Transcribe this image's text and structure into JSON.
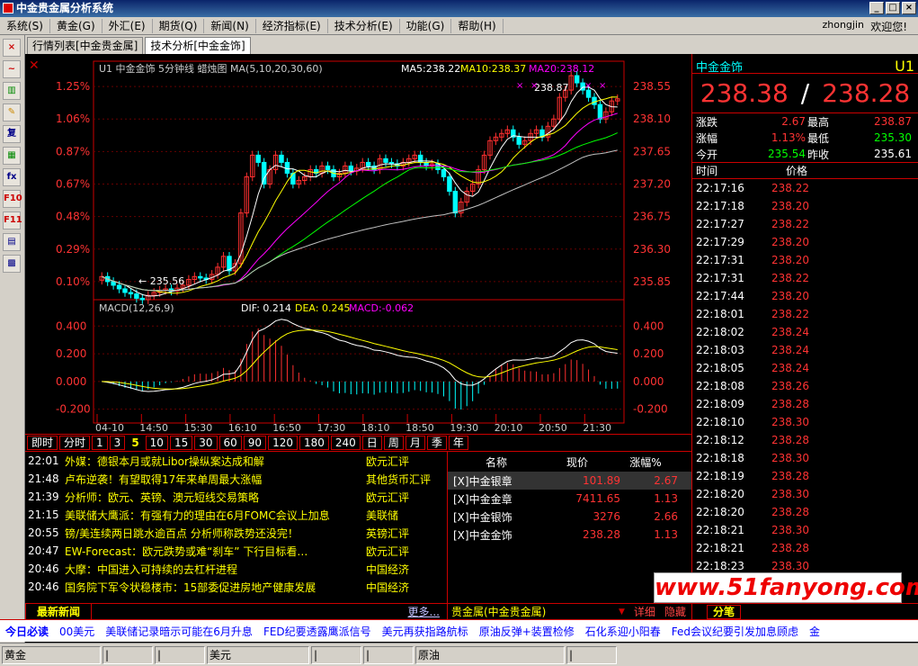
{
  "window": {
    "title": "中金贵金属分析系统"
  },
  "menu": {
    "items": [
      "系统(S)",
      "黄金(G)",
      "外汇(E)",
      "期货(Q)",
      "新闻(N)",
      "经济指标(E)",
      "技术分析(E)",
      "功能(G)",
      "帮助(H)"
    ],
    "user": "zhongjin",
    "welcome": "欢迎您!"
  },
  "tabs": [
    "行情列表[中金贵金属]",
    "技术分析[中金金饰]"
  ],
  "toolbar_icons": [
    "×",
    "~",
    "▥",
    "✎",
    "复",
    "▦",
    "fx",
    "F10",
    "F11",
    "▤",
    "▩"
  ],
  "chart": {
    "header": "U1 中金金饰 5分钟线 蜡烛图 MA(5,10,20,30,60)",
    "ma5": "MA5:238.22",
    "ma10": "MA10:238.37",
    "ma20": "MA20:238.12",
    "high_mark": "238.87",
    "low_mark": "← 235.56",
    "pct_labels": [
      "1.25%",
      "1.06%",
      "0.87%",
      "0.67%",
      "0.48%",
      "0.29%",
      "0.10%"
    ],
    "price_labels": [
      "238.55",
      "238.10",
      "237.65",
      "237.20",
      "236.75",
      "236.30",
      "235.85"
    ],
    "macd_header": "MACD(12,26,9)",
    "dif": "DIF: 0.214",
    "dea": "DEA: 0.245",
    "macd": "MACD:-0.062",
    "macd_labels": [
      "0.400",
      "0.200",
      "0.000",
      "-0.200"
    ],
    "time_labels": [
      "04-10",
      "14:50",
      "15:30",
      "16:10",
      "16:50",
      "17:30",
      "18:10",
      "18:50",
      "19:30",
      "20:10",
      "20:50",
      "21:30"
    ],
    "colors": {
      "up": "#ff3030",
      "down": "#00ffff",
      "ma5": "#ffffff",
      "ma10": "#ffff00",
      "ma20": "#ff00ff",
      "ma30": "#00ff00",
      "ma60": "#c0c0c0"
    }
  },
  "chart_data": {
    "type": "candlestick",
    "title": "U1 中金金饰 5分钟线 蜡烛图 MA(5,10,20,30,60)",
    "ylim": [
      235.6,
      238.9
    ],
    "close": [
      235.92,
      235.85,
      235.8,
      235.75,
      235.7,
      235.68,
      235.62,
      235.6,
      235.66,
      235.7,
      235.73,
      235.75,
      235.72,
      235.76,
      235.8,
      235.88,
      235.92,
      235.9,
      235.88,
      235.95,
      236.05,
      236.2,
      236.0,
      236.1,
      236.8,
      237.3,
      237.6,
      237.5,
      237.2,
      237.4,
      237.6,
      237.5,
      237.35,
      237.2,
      237.25,
      237.3,
      237.4,
      237.35,
      237.45,
      237.4,
      237.3,
      237.35,
      237.45,
      237.38,
      237.42,
      237.5,
      237.45,
      237.4,
      237.55,
      237.5,
      237.48,
      237.45,
      237.5,
      237.55,
      237.6,
      237.5,
      237.45,
      237.48,
      237.4,
      237.3,
      237.1,
      236.8,
      236.95,
      237.1,
      237.2,
      237.4,
      237.6,
      237.8,
      237.85,
      237.9,
      237.95,
      237.85,
      237.75,
      237.8,
      237.9,
      237.95,
      237.85,
      238.0,
      238.1,
      238.4,
      238.5,
      238.7,
      238.6,
      238.5,
      238.4,
      238.3,
      238.1,
      238.2,
      238.35,
      238.38
    ]
  },
  "quote": {
    "symbol_name": "中金金饰",
    "symbol_code": "U1",
    "bid": "238.38",
    "sep": "/",
    "ask": "238.28",
    "rows": [
      [
        "涨跌",
        "2.67",
        "最高",
        "238.87"
      ],
      [
        "涨幅",
        "1.13%",
        "最低",
        "235.30"
      ],
      [
        "今开",
        "235.54",
        "昨收",
        "235.61"
      ]
    ],
    "ticks_header": [
      "时间",
      "价格"
    ],
    "ticks": [
      [
        "22:17:16",
        "238.22"
      ],
      [
        "22:17:18",
        "238.20"
      ],
      [
        "22:17:27",
        "238.22"
      ],
      [
        "22:17:29",
        "238.20"
      ],
      [
        "22:17:31",
        "238.20"
      ],
      [
        "22:17:31",
        "238.22"
      ],
      [
        "22:17:44",
        "238.20"
      ],
      [
        "22:18:01",
        "238.22"
      ],
      [
        "22:18:02",
        "238.24"
      ],
      [
        "22:18:03",
        "238.24"
      ],
      [
        "22:18:05",
        "238.24"
      ],
      [
        "22:18:08",
        "238.26"
      ],
      [
        "22:18:09",
        "238.28"
      ],
      [
        "22:18:10",
        "238.30"
      ],
      [
        "22:18:12",
        "238.28"
      ],
      [
        "22:18:18",
        "238.30"
      ],
      [
        "22:18:19",
        "238.28"
      ],
      [
        "22:18:20",
        "238.30"
      ],
      [
        "22:18:20",
        "238.28"
      ],
      [
        "22:18:21",
        "238.30"
      ],
      [
        "22:18:21",
        "238.28"
      ],
      [
        "22:18:23",
        "238.30"
      ]
    ],
    "bottom_tab": "分笔"
  },
  "periods": [
    "即时",
    "分时",
    "1",
    "3",
    "5",
    "10",
    "15",
    "30",
    "60",
    "90",
    "120",
    "180",
    "240",
    "日",
    "周",
    "月",
    "季",
    "年"
  ],
  "active_period": "5",
  "news": {
    "items": [
      [
        "22:01",
        "外媒：德银本月或就Libor操纵案达成和解",
        "欧元汇评"
      ],
      [
        "21:48",
        "卢布逆袭！有望取得17年来单周最大涨幅",
        "其他货币汇评"
      ],
      [
        "21:39",
        "分析师：欧元、英镑、澳元短线交易策略",
        "欧元汇评"
      ],
      [
        "21:15",
        "美联储大鹰派：有强有力的理由在6月FOMC会议上加息",
        "美联储"
      ],
      [
        "20:55",
        "镑/美连续两日跳水逾百点 分析师称跌势还没完！",
        "英镑汇评"
      ],
      [
        "20:47",
        "EW-Forecast：欧元跌势或难“刹车” 下行目标看…",
        "欧元汇评"
      ],
      [
        "20:46",
        "大摩：中国进入可持续的去杠杆进程",
        "中国经济"
      ],
      [
        "20:46",
        "国务院下军令状稳楼市：15部委促进房地产健康发展",
        "中国经济"
      ]
    ],
    "tab_label": "最新新闻",
    "more": "更多..."
  },
  "watchlist": {
    "headers": [
      "名称",
      "现价",
      "涨幅%"
    ],
    "rows": [
      [
        "[X]中金银章",
        "101.89",
        "2.67"
      ],
      [
        "[X]中金金章",
        "7411.65",
        "1.13"
      ],
      [
        "[X]中金银饰",
        "3276",
        "2.66"
      ],
      [
        "[X]中金金饰",
        "238.28",
        "1.13"
      ]
    ],
    "footer_label": "贵金属(中金贵金属)",
    "detail": "详细",
    "hide": "隐藏"
  },
  "ticker": {
    "label": "今日必读",
    "items": [
      "00美元",
      "美联储记录暗示可能在6月升息",
      "FED纪要透露鹰派信号",
      "美元再获指路航标",
      "原油反弹+装置检修",
      "石化系迎小阳春",
      "Fed会议纪要引发加息顾虑",
      "金"
    ]
  },
  "status": [
    "黄金",
    "|",
    "|",
    "美元",
    "|",
    "|",
    "原油",
    "|"
  ],
  "watermark": "www.51fanyong.com"
}
